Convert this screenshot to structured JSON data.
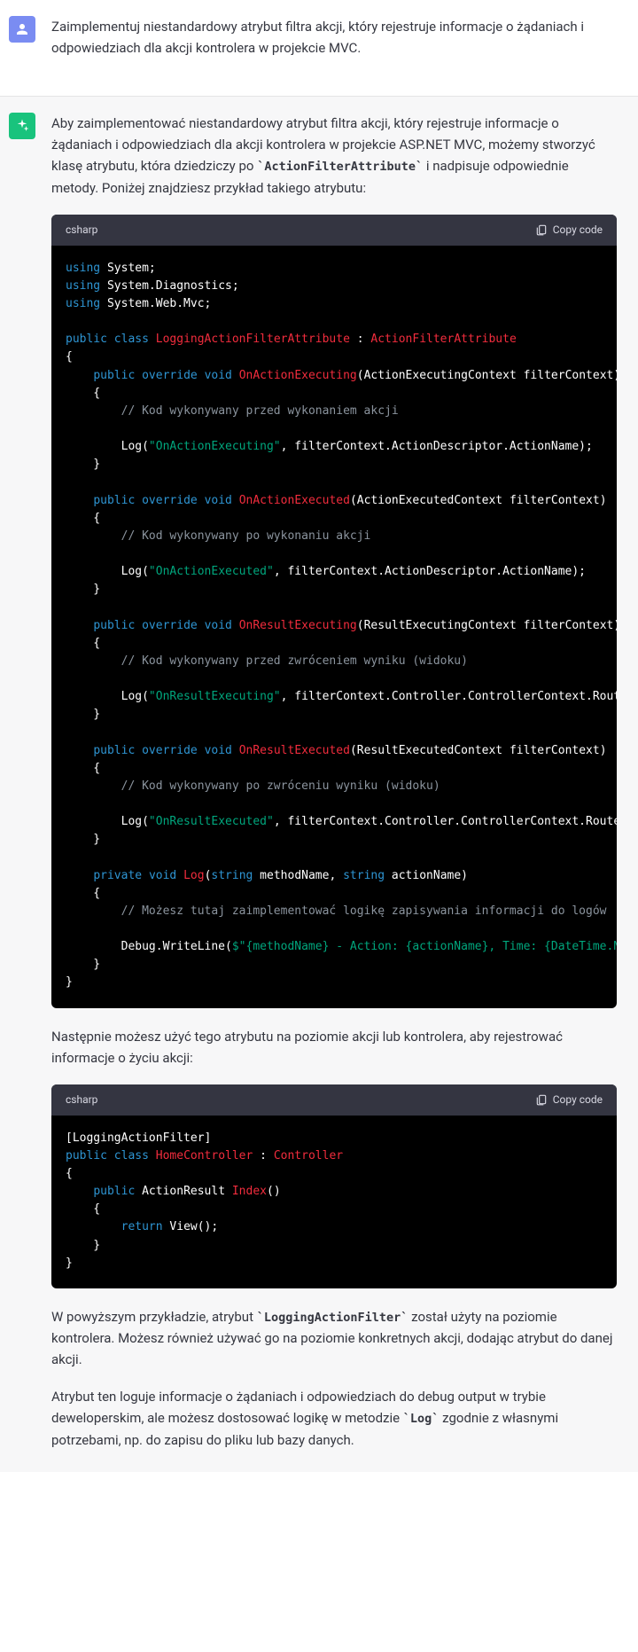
{
  "user": {
    "text": "Zaimplementuj niestandardowy atrybut filtra akcji, który rejestruje informacje o żądaniach i odpowiedziach dla akcji kontrolera w projekcie MVC."
  },
  "assistant": {
    "intro_parts": {
      "a": "Aby zaimplementować niestandardowy atrybut filtra akcji, który rejestruje informacje o żądaniach i odpowiedziach dla akcji kontrolera w projekcie ASP.NET MVC, możemy stworzyć klasę atrybutu, która dziedziczy po ",
      "code1": "`ActionFilterAttribute`",
      "b": " i nadpisuje odpowiednie metody. Poniżej znajdziesz przykład takiego atrybutu:"
    },
    "code1": {
      "lang": "csharp",
      "copy": "Copy code"
    },
    "mid": "Następnie możesz użyć tego atrybutu na poziomie akcji lub kontrolera, aby rejestrować informacje o życiu akcji:",
    "code2": {
      "lang": "csharp",
      "copy": "Copy code"
    },
    "outro1_parts": {
      "a": "W powyższym przykładzie, atrybut ",
      "code1": "`LoggingActionFilter`",
      "b": " został użyty na poziomie kontrolera. Możesz również używać go na poziomie konkretnych akcji, dodając atrybut do danej akcji."
    },
    "outro2_parts": {
      "a": "Atrybut ten loguje informacje o żądaniach i odpowiedziach do debug output w trybie deweloperskim, ale możesz dostosować logikę w metodzie ",
      "code1": "`Log`",
      "b": " zgodnie z własnymi potrzebami, np. do zapisu do pliku lub bazy danych."
    }
  }
}
